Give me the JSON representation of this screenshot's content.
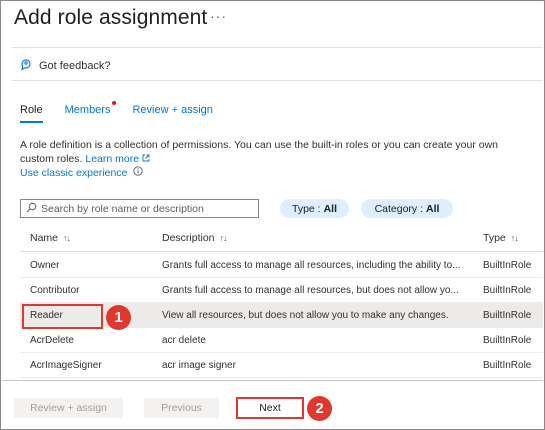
{
  "header": {
    "title": "Add role assignment",
    "more": "···"
  },
  "feedback": {
    "label": "Got feedback?"
  },
  "tabs": [
    {
      "label": "Role"
    },
    {
      "label": "Members"
    },
    {
      "label": "Review + assign"
    }
  ],
  "intro": {
    "text": "A role definition is a collection of permissions. You can use the built-in roles or you can create your own custom roles.",
    "learn_more": "Learn more",
    "classic_link": "Use classic experience"
  },
  "filters": {
    "search_placeholder": "Search by role name or description",
    "type_label": "Type :",
    "type_value": "All",
    "category_label": "Category :",
    "category_value": "All"
  },
  "table": {
    "headers": {
      "name": "Name",
      "description": "Description",
      "type": "Type"
    },
    "rows": [
      {
        "name": "Owner",
        "description": "Grants full access to manage all resources, including the ability to...",
        "type": "BuiltInRole"
      },
      {
        "name": "Contributor",
        "description": "Grants full access to manage all resources, but does not allow yo...",
        "type": "BuiltInRole"
      },
      {
        "name": "Reader",
        "description": "View all resources, but does not allow you to make any changes.",
        "type": "BuiltInRole"
      },
      {
        "name": "AcrDelete",
        "description": "acr delete",
        "type": "BuiltInRole"
      },
      {
        "name": "AcrImageSigner",
        "description": "acr image signer",
        "type": "BuiltInRole"
      }
    ]
  },
  "callouts": {
    "first": "1",
    "second": "2"
  },
  "footer": {
    "review_label": "Review + assign",
    "previous_label": "Previous",
    "next_label": "Next"
  },
  "colors": {
    "accent": "#0078d4",
    "callout": "#e0372f",
    "pill_bg": "#dceeff",
    "selected_row": "#edebe9"
  }
}
